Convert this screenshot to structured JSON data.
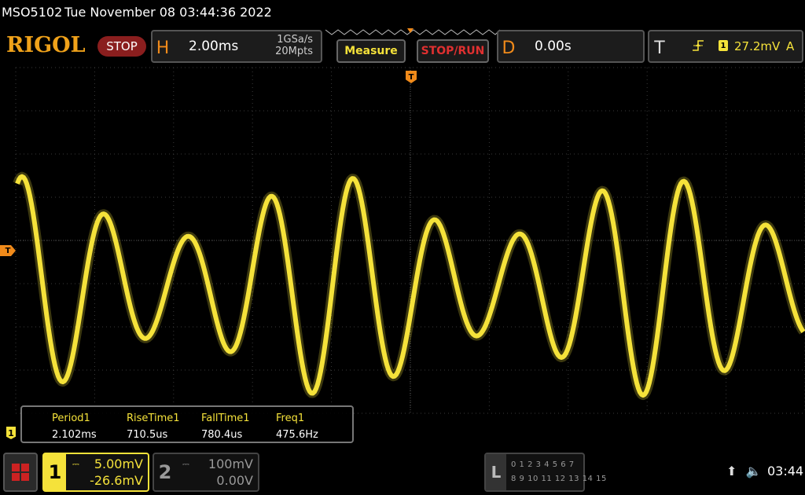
{
  "title_bar": {
    "model": "MSO5102",
    "datetime": "Tue November 08 03:44:36 2022"
  },
  "toolbar": {
    "logo": "RIGOL",
    "run_state": "STOP",
    "horizontal": {
      "letter": "H",
      "timebase": "2.00ms",
      "sample_rate": "1GSa/s",
      "memory_depth": "20Mpts"
    },
    "measure_label": "Measure",
    "stoprun_label": "STOP/RUN",
    "delay": {
      "letter": "D",
      "value": "0.00s"
    },
    "trigger": {
      "letter": "T",
      "source": "1",
      "level": "27.2mV",
      "mode": "A"
    }
  },
  "screen": {
    "trigger_marker": "T",
    "trigger_position_marker": "T",
    "ch1_ref_marker": "1",
    "colors": {
      "trace": "#f5e23a",
      "grid": "#3a3a3a",
      "marker": "#f08a1a"
    }
  },
  "measurements": [
    {
      "label": "Period1",
      "value": "2.102ms"
    },
    {
      "label": "RiseTime1",
      "value": "710.5us"
    },
    {
      "label": "FallTime1",
      "value": "780.4us"
    },
    {
      "label": "Freq1",
      "value": "475.6Hz"
    }
  ],
  "bottom": {
    "ch1": {
      "number": "1",
      "scale": "5.00mV",
      "offset": "-26.6mV"
    },
    "ch2": {
      "number": "2",
      "scale": "100mV",
      "offset": "0.00V"
    },
    "la": {
      "letter": "L",
      "row1": "0 1 2 3   4 5 6 7",
      "row2": "8 9 10 11 12 13 14 15"
    },
    "clock": "03:44"
  }
}
